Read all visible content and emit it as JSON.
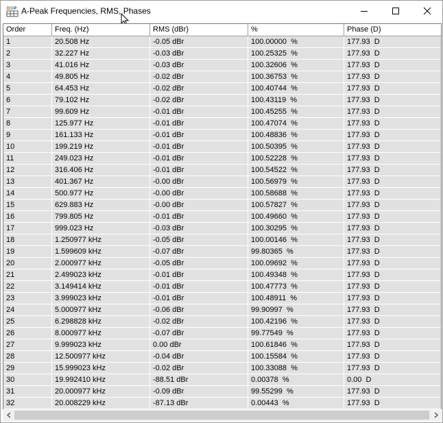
{
  "window": {
    "title": "A-Peak Frequencies, RMS, Phases",
    "icon": "table-grid-icon"
  },
  "controls": {
    "minimize": "minimize-icon",
    "maximize": "maximize-icon",
    "close": "close-icon"
  },
  "table": {
    "columns": [
      "Order",
      "Freq. (Hz)",
      "RMS (dBr)",
      "%",
      "Phase (D)"
    ],
    "rows": [
      [
        "1",
        "20.508 Hz",
        "-0.05 dBr",
        "100.00000  %",
        "177.93  D"
      ],
      [
        "2",
        "32.227 Hz",
        "-0.03 dBr",
        "100.25325  %",
        "177.93  D"
      ],
      [
        "3",
        "41.016 Hz",
        "-0.03 dBr",
        "100.32606  %",
        "177.93  D"
      ],
      [
        "4",
        "49.805 Hz",
        "-0.02 dBr",
        "100.36753  %",
        "177.93  D"
      ],
      [
        "5",
        "64.453 Hz",
        "-0.02 dBr",
        "100.40744  %",
        "177.93  D"
      ],
      [
        "6",
        "79.102 Hz",
        "-0.02 dBr",
        "100.43119  %",
        "177.93  D"
      ],
      [
        "7",
        "99.609 Hz",
        "-0.01 dBr",
        "100.45255  %",
        "177.93  D"
      ],
      [
        "8",
        "125.977 Hz",
        "-0.01 dBr",
        "100.47074  %",
        "177.93  D"
      ],
      [
        "9",
        "161.133 Hz",
        "-0.01 dBr",
        "100.48836  %",
        "177.93  D"
      ],
      [
        "10",
        "199.219 Hz",
        "-0.01 dBr",
        "100.50395  %",
        "177.93  D"
      ],
      [
        "11",
        "249.023 Hz",
        "-0.01 dBr",
        "100.52228  %",
        "177.93  D"
      ],
      [
        "12",
        "316.406 Hz",
        "-0.01 dBr",
        "100.54522  %",
        "177.93  D"
      ],
      [
        "13",
        "401.367 Hz",
        "-0.00 dBr",
        "100.56979  %",
        "177.93  D"
      ],
      [
        "14",
        "500.977 Hz",
        "-0.00 dBr",
        "100.58688  %",
        "177.93  D"
      ],
      [
        "15",
        "629.883 Hz",
        "-0.00 dBr",
        "100.57827  %",
        "177.93  D"
      ],
      [
        "16",
        "799.805 Hz",
        "-0.01 dBr",
        "100.49660  %",
        "177.93  D"
      ],
      [
        "17",
        "999.023 Hz",
        "-0.03 dBr",
        "100.30295  %",
        "177.93  D"
      ],
      [
        "18",
        "1.250977 kHz",
        "-0.05 dBr",
        "100.00146  %",
        "177.93  D"
      ],
      [
        "19",
        "1.599609 kHz",
        "-0.07 dBr",
        "99.80365  %",
        "177.93  D"
      ],
      [
        "20",
        "2.000977 kHz",
        "-0.05 dBr",
        "100.09692  %",
        "177.93  D"
      ],
      [
        "21",
        "2.499023 kHz",
        "-0.01 dBr",
        "100.49348  %",
        "177.93  D"
      ],
      [
        "22",
        "3.149414 kHz",
        "-0.01 dBr",
        "100.47773  %",
        "177.93  D"
      ],
      [
        "23",
        "3.999023 kHz",
        "-0.01 dBr",
        "100.48911  %",
        "177.93  D"
      ],
      [
        "24",
        "5.000977 kHz",
        "-0.06 dBr",
        "99.90997  %",
        "177.93  D"
      ],
      [
        "25",
        "6.298828 kHz",
        "-0.02 dBr",
        "100.42196  %",
        "177.93  D"
      ],
      [
        "26",
        "8.000977 kHz",
        "-0.07 dBr",
        "99.77549  %",
        "177.93  D"
      ],
      [
        "27",
        "9.999023 kHz",
        "0.00 dBr",
        "100.61846  %",
        "177.93  D"
      ],
      [
        "28",
        "12.500977 kHz",
        "-0.04 dBr",
        "100.15584  %",
        "177.93  D"
      ],
      [
        "29",
        "15.999023 kHz",
        "-0.02 dBr",
        "100.33088  %",
        "177.93  D"
      ],
      [
        "30",
        "19.992410 kHz",
        "-88.51 dBr",
        "0.00378  %",
        "0.00  D"
      ],
      [
        "31",
        "20.000977 kHz",
        "-0.09 dBr",
        "99.55299  %",
        "177.93  D"
      ],
      [
        "32",
        "20.008229 kHz",
        "-87.13 dBr",
        "0.00443  %",
        "177.93  D"
      ]
    ]
  },
  "scrollbar": {
    "left_arrow": "chevron-left-icon",
    "right_arrow": "chevron-right-icon"
  },
  "colors": {
    "row_background": "#e1e1e1",
    "grid_line": "#ffffff",
    "header_border": "#a0a0a0"
  }
}
